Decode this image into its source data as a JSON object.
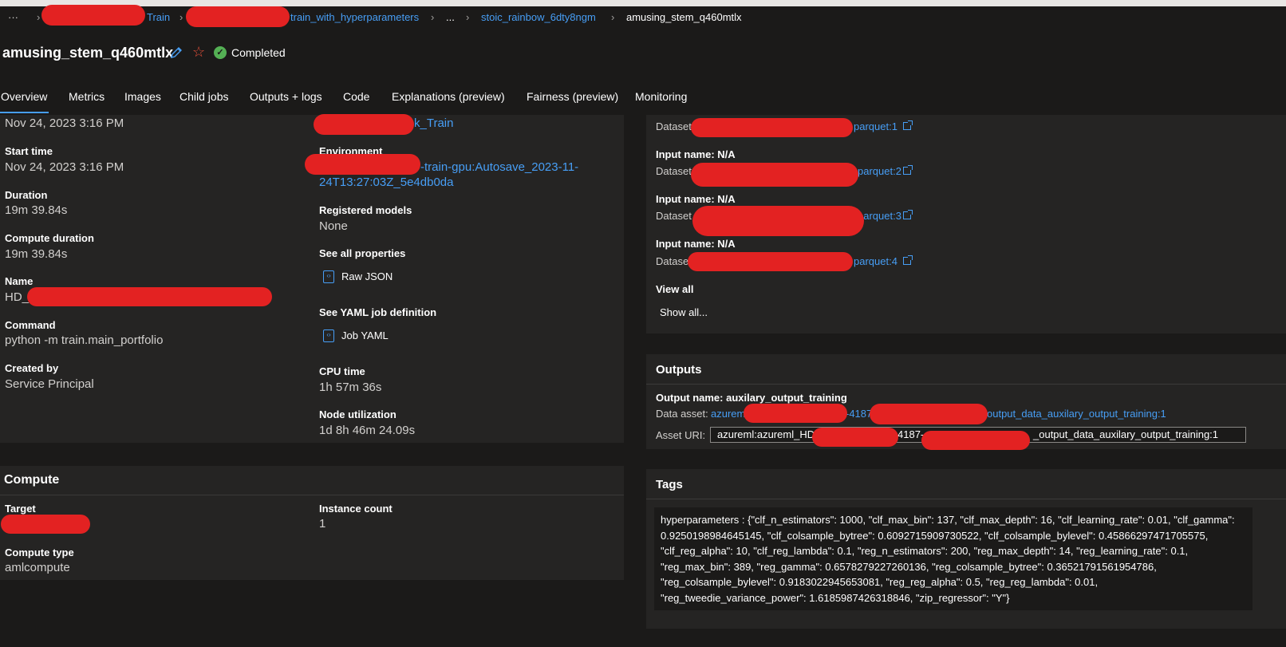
{
  "breadcrumb": {
    "more": "···",
    "items": [
      "Train",
      "train_with_hyperparameters",
      "...",
      "stoic_rainbow_6dty8ngm",
      "amusing_stem_q460mtlx"
    ]
  },
  "header": {
    "title": "amusing_stem_q460mtlx",
    "status": "Completed"
  },
  "tabs": [
    "Overview",
    "Metrics",
    "Images",
    "Child jobs",
    "Outputs + logs",
    "Code",
    "Explanations (preview)",
    "Fairness (preview)",
    "Monitoring"
  ],
  "properties": {
    "created_value": "Nov 24, 2023 3:16 PM",
    "start_time_label": "Start time",
    "start_time_value": "Nov 24, 2023 3:16 PM",
    "duration_label": "Duration",
    "duration_value": "19m 39.84s",
    "compute_duration_label": "Compute duration",
    "compute_duration_value": "19m 39.84s",
    "name_label": "Name",
    "name_value": "HD_",
    "command_label": "Command",
    "command_value": "python -m train.main_portfolio",
    "created_by_label": "Created by",
    "created_by_value": "Service Principal",
    "experiment_value": "k_Train",
    "environment_label": "Environment",
    "environment_line1": "-train-gpu:Autosave_2023-11-",
    "environment_line2": "24T13:27:03Z_5e4db0da",
    "registered_models_label": "Registered models",
    "registered_models_value": "None",
    "see_all_properties_label": "See all properties",
    "raw_json": "Raw JSON",
    "see_yaml_label": "See YAML job definition",
    "job_yaml": "Job YAML",
    "cpu_time_label": "CPU time",
    "cpu_time_value": "1h 57m 36s",
    "node_util_label": "Node utilization",
    "node_util_value": "1d 8h 46m 24.09s"
  },
  "compute": {
    "title": "Compute",
    "target_label": "Target",
    "instance_count_label": "Instance count",
    "instance_count_value": "1",
    "compute_type_label": "Compute type",
    "compute_type_value": "amlcompute"
  },
  "inputs": {
    "items": [
      {
        "dataset_prefix": "Dataset",
        "link_tail": "parquet:1"
      },
      {
        "name": "Input name: N/A",
        "dataset_prefix": "Dataset",
        "link_tail": "parquet:2"
      },
      {
        "name": "Input name: N/A",
        "dataset_prefix": "Dataset",
        "link_tail": "parquet:3"
      },
      {
        "name": "Input name: N/A",
        "dataset_prefix": "Datase",
        "link_tail": "parquet:4"
      }
    ],
    "view_all_label": "View all",
    "show_all": "Show all..."
  },
  "outputs": {
    "title": "Outputs",
    "output_name": "Output name: auxilary_output_training",
    "data_asset_label": "Data asset:",
    "data_asset_link_start": "azureml",
    "data_asset_link_mid": "-4187",
    "data_asset_link_end": "output_data_auxilary_output_training:1",
    "asset_uri_label": "Asset URI:",
    "asset_uri_start": "azureml:azureml_HD",
    "asset_uri_mid": "4187-",
    "asset_uri_end": "_output_data_auxilary_output_training:1"
  },
  "tags": {
    "title": "Tags",
    "text": "hyperparameters : {\"clf_n_estimators\": 1000, \"clf_max_bin\": 137, \"clf_max_depth\": 16, \"clf_learning_rate\": 0.01, \"clf_gamma\": 0.9250198984645145, \"clf_colsample_bytree\": 0.6092715909730522, \"clf_colsample_bylevel\": 0.45866297471705575, \"clf_reg_alpha\": 10, \"clf_reg_lambda\": 0.1, \"reg_n_estimators\": 200, \"reg_max_depth\": 14, \"reg_learning_rate\": 0.1, \"reg_max_bin\": 389, \"reg_gamma\": 0.6578279227260136, \"reg_colsample_bytree\": 0.36521791561954786, \"reg_colsample_bylevel\": 0.9183022945653081, \"reg_reg_alpha\": 0.5, \"reg_reg_lambda\": 0.01, \"reg_tweedie_variance_power\": 1.6185987426318846, \"zip_regressor\": \"Y\"}"
  },
  "icons": {
    "pencil": "pencil-icon",
    "star": "star-icon",
    "status": "check-circle-icon",
    "document": "code-document-icon",
    "external": "external-link-icon"
  },
  "colors": {
    "accent": "#479ef5",
    "success": "#54b054",
    "favorite": "#e8503a",
    "background": "#1b1a19",
    "panel": "#252423"
  }
}
